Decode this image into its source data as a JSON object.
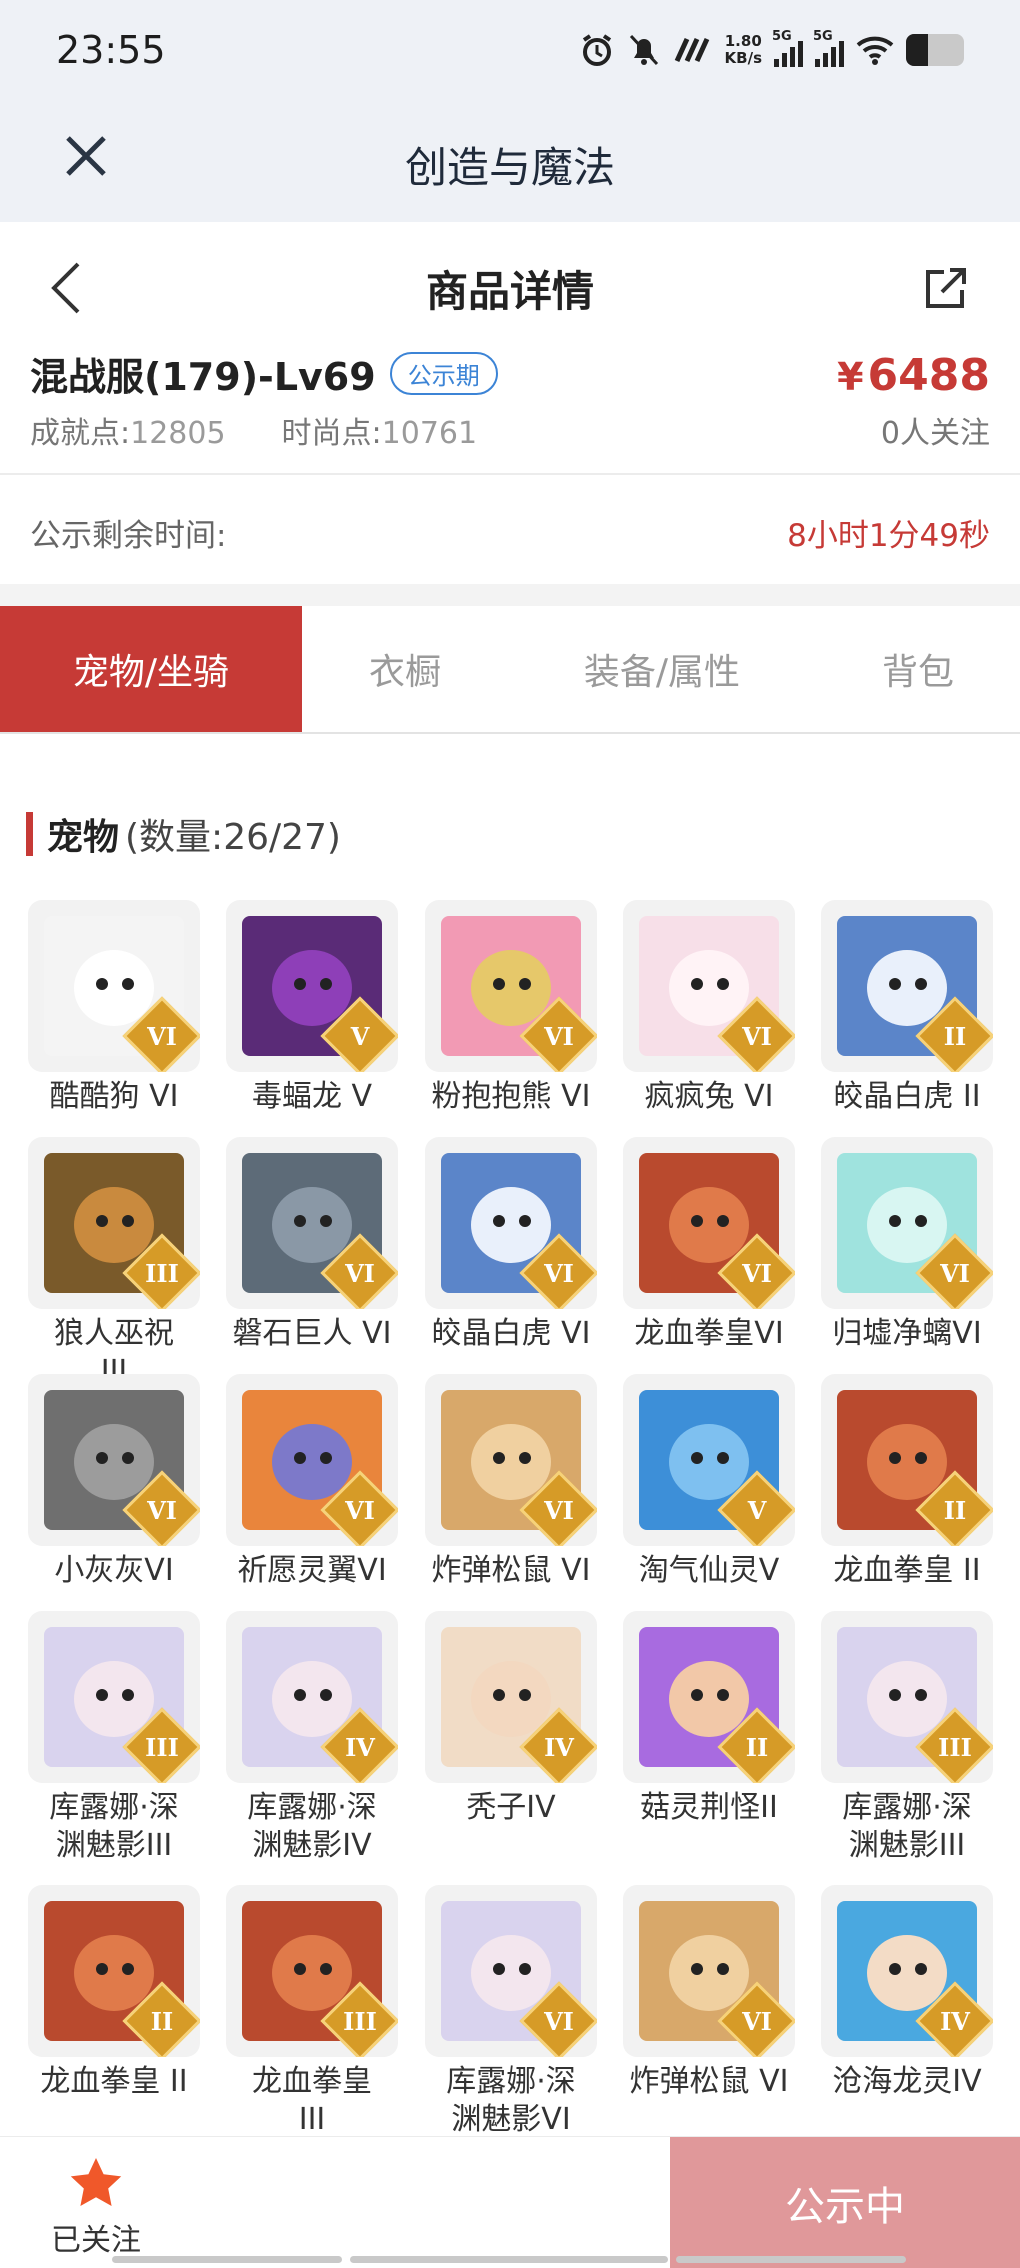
{
  "status_bar": {
    "time": "23:55",
    "net_speed_value": "1.80",
    "net_speed_unit": "KB/s",
    "sig1": "5G",
    "sig2": "5G",
    "battery_level": 0.38
  },
  "app": {
    "title": "创造与魔法"
  },
  "detail": {
    "title": "商品详情"
  },
  "product": {
    "name": "混战服(179)-Lv69",
    "badge": "公示期",
    "price_symbol": "¥",
    "price": "6488",
    "achievement_label": "成就点:",
    "achievement_value": "12805",
    "fashion_label": "时尚点:",
    "fashion_value": "10761",
    "followers": "0人关注"
  },
  "countdown": {
    "label": "公示剩余时间:",
    "value": "8小时1分49秒"
  },
  "tabs": [
    "宠物/坐骑",
    "衣橱",
    "装备/属性",
    "背包"
  ],
  "section": {
    "title": "宠物",
    "count": "(数量:26/27)"
  },
  "pets": [
    {
      "name": "酷酷狗 VI",
      "tier": "VI",
      "color": "#f4f4f4",
      "face": "#ffffff"
    },
    {
      "name": "毒蝠龙 V",
      "tier": "V",
      "color": "#5a2b77",
      "face": "#8e3fb8"
    },
    {
      "name": "粉抱抱熊 VI",
      "tier": "VI",
      "color": "#f29ab4",
      "face": "#e6c86a"
    },
    {
      "name": "疯疯兔 VI",
      "tier": "VI",
      "color": "#f7dfe8",
      "face": "#fff3f6"
    },
    {
      "name": "皎晶白虎 II",
      "tier": "II",
      "color": "#5b85c9",
      "face": "#e9f0fb"
    },
    {
      "name": "狼人巫祝 III",
      "tier": "III",
      "color": "#7a5a2a",
      "face": "#c98a3e"
    },
    {
      "name": "磐石巨人 VI",
      "tier": "VI",
      "color": "#5d6b78",
      "face": "#8a98a6"
    },
    {
      "name": "皎晶白虎 VI",
      "tier": "VI",
      "color": "#5b85c9",
      "face": "#e9f0fb"
    },
    {
      "name": "龙血拳皇VI",
      "tier": "VI",
      "color": "#b94a2e",
      "face": "#e07a4a"
    },
    {
      "name": "归墟净螭VI",
      "tier": "VI",
      "color": "#9fe3de",
      "face": "#d8f6f2"
    },
    {
      "name": "小灰灰VI",
      "tier": "VI",
      "color": "#6f6f6f",
      "face": "#9c9c9c"
    },
    {
      "name": "祈愿灵翼VI",
      "tier": "VI",
      "color": "#e9853c",
      "face": "#7d79c9"
    },
    {
      "name": "炸弹松鼠 VI",
      "tier": "VI",
      "color": "#d8a86a",
      "face": "#f0d0a0"
    },
    {
      "name": "淘气仙灵V",
      "tier": "V",
      "color": "#3d8fd8",
      "face": "#7ec0f0"
    },
    {
      "name": "龙血拳皇 II",
      "tier": "II",
      "color": "#b94a2e",
      "face": "#e07a4a"
    },
    {
      "name": "库露娜·深渊魅影III",
      "tier": "III",
      "color": "#d9d3ee",
      "face": "#f3e6ee"
    },
    {
      "name": "库露娜·深渊魅影IV",
      "tier": "IV",
      "color": "#d9d3ee",
      "face": "#f3e6ee"
    },
    {
      "name": "秃子IV",
      "tier": "IV",
      "color": "#f1dcc6",
      "face": "#f3d8c0"
    },
    {
      "name": "菇灵荆怪II",
      "tier": "II",
      "color": "#a86be0",
      "face": "#f2c8a8"
    },
    {
      "name": "库露娜·深渊魅影III",
      "tier": "III",
      "color": "#d9d3ee",
      "face": "#f3e6ee"
    },
    {
      "name": "龙血拳皇 II",
      "tier": "II",
      "color": "#b94a2e",
      "face": "#e07a4a"
    },
    {
      "name": "龙血拳皇 III",
      "tier": "III",
      "color": "#b94a2e",
      "face": "#e07a4a"
    },
    {
      "name": "库露娜·深渊魅影VI",
      "tier": "VI",
      "color": "#d9d3ee",
      "face": "#f3e6ee"
    },
    {
      "name": "炸弹松鼠 VI",
      "tier": "VI",
      "color": "#d8a86a",
      "face": "#f0d0a0"
    },
    {
      "name": "沧海龙灵IV",
      "tier": "IV",
      "color": "#4aa8e0",
      "face": "#f3dcc6"
    }
  ],
  "bottom": {
    "follow_label": "已关注",
    "action_label": "公示中"
  },
  "colors": {
    "accent": "#c63a36",
    "badge": "#3c84d6",
    "action_disabled": "#e0989a",
    "star": "#f0582a"
  }
}
